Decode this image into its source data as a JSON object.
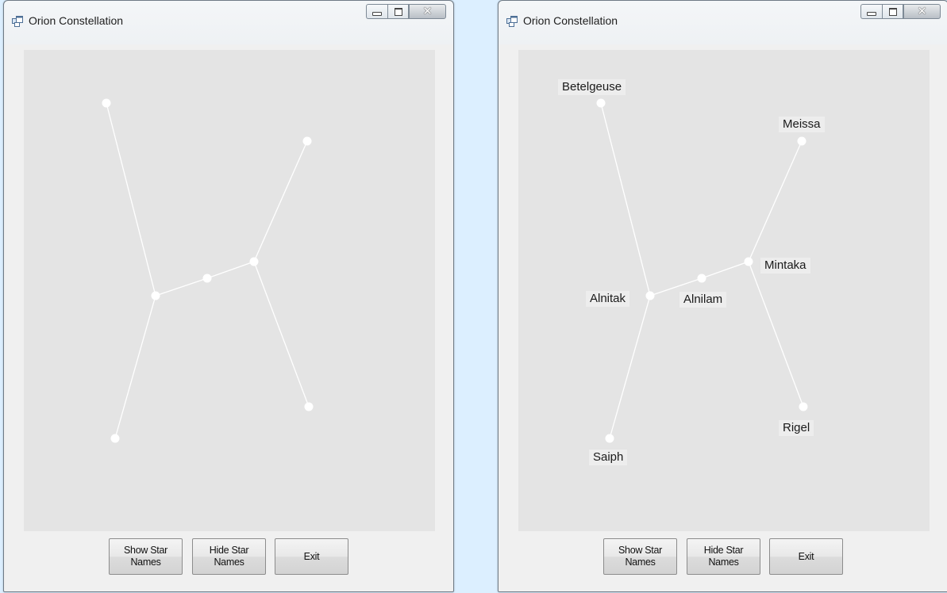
{
  "windows": [
    {
      "title": "Orion Constellation",
      "buttons": {
        "show_names": "Show Star Names",
        "hide_names": "Hide Star Names",
        "exit": "Exit"
      },
      "labels_visible": false
    },
    {
      "title": "Orion Constellation",
      "buttons": {
        "show_names": "Show Star Names",
        "hide_names": "Hide Star Names",
        "exit": "Exit"
      },
      "labels_visible": true
    }
  ],
  "stars": [
    {
      "id": "betelgeuse",
      "name": "Betelgeuse"
    },
    {
      "id": "meissa",
      "name": "Meissa"
    },
    {
      "id": "mintaka",
      "name": "Mintaka"
    },
    {
      "id": "alnilam",
      "name": "Alnilam"
    },
    {
      "id": "alnitak",
      "name": "Alnitak"
    },
    {
      "id": "rigel",
      "name": "Rigel"
    },
    {
      "id": "saiph",
      "name": "Saiph"
    }
  ],
  "constellation_lines": [
    [
      "betelgeuse",
      "alnitak"
    ],
    [
      "alnitak",
      "alnilam"
    ],
    [
      "alnilam",
      "mintaka"
    ],
    [
      "mintaka",
      "meissa"
    ],
    [
      "mintaka",
      "rigel"
    ],
    [
      "alnitak",
      "saiph"
    ]
  ],
  "colors": {
    "desktop": "#dcefff",
    "canvas": "#e4e4e4",
    "star": "#ffffff",
    "line": "#ffffff",
    "label_bg": "#ededed"
  },
  "icons": {
    "app": "form-icon",
    "minimize": "minimize-icon",
    "maximize": "maximize-icon",
    "close": "close-icon"
  }
}
